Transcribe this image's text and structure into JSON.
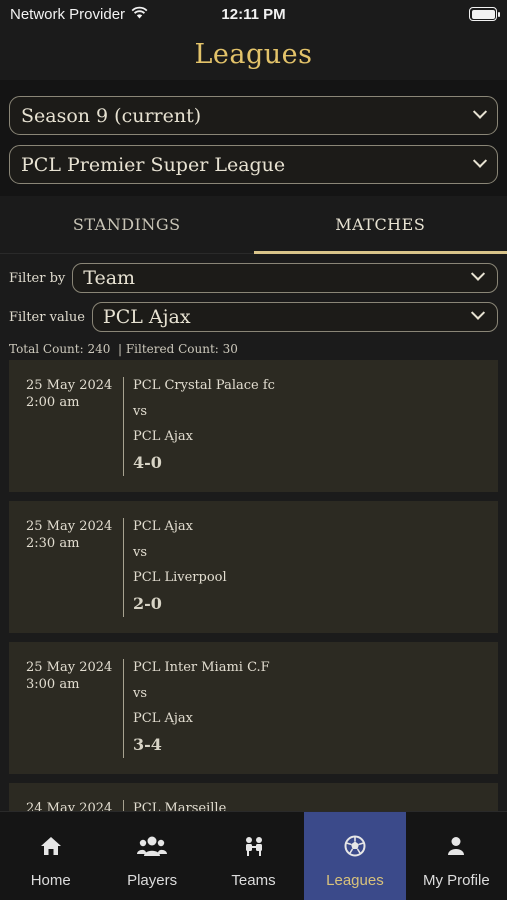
{
  "status_bar": {
    "carrier": "Network Provider",
    "time": "12:11 PM"
  },
  "header": {
    "title": "Leagues"
  },
  "selectors": {
    "season": "Season 9 (current)",
    "league": "PCL Premier Super League"
  },
  "tabs": [
    {
      "label": "STANDINGS",
      "active": false
    },
    {
      "label": "MATCHES",
      "active": true
    }
  ],
  "filters": {
    "filter_by_label": "Filter by",
    "filter_by_value": "Team",
    "filter_value_label": "Filter value",
    "filter_value_value": "PCL Ajax"
  },
  "counts": {
    "text": "Total Count: 240  | Filtered Count: 30"
  },
  "matches": [
    {
      "date": "25 May 2024",
      "time": "2:00 am",
      "home": "PCL Crystal Palace fc",
      "vs": "vs",
      "away": "PCL Ajax",
      "score": "4-0"
    },
    {
      "date": "25 May 2024",
      "time": "2:30 am",
      "home": "PCL Ajax",
      "vs": "vs",
      "away": "PCL Liverpool",
      "score": "2-0"
    },
    {
      "date": "25 May 2024",
      "time": "3:00 am",
      "home": "PCL Inter Miami C.F",
      "vs": "vs",
      "away": "PCL Ajax",
      "score": "3-4"
    },
    {
      "date": "24 May 2024",
      "time": "",
      "home": "PCL Marseille",
      "vs": "",
      "away": "",
      "score": ""
    }
  ],
  "tabbar": [
    {
      "label": "Home",
      "icon": "home-icon",
      "active": false
    },
    {
      "label": "Players",
      "icon": "players-icon",
      "active": false
    },
    {
      "label": "Teams",
      "icon": "teams-icon",
      "active": false
    },
    {
      "label": "Leagues",
      "icon": "soccer-ball-icon",
      "active": true
    },
    {
      "label": "My Profile",
      "icon": "profile-icon",
      "active": false
    }
  ],
  "colors": {
    "accent_gold": "#e3c36a",
    "active_tab_bg": "#3b4a8a",
    "card_bg": "#2c2a22"
  }
}
